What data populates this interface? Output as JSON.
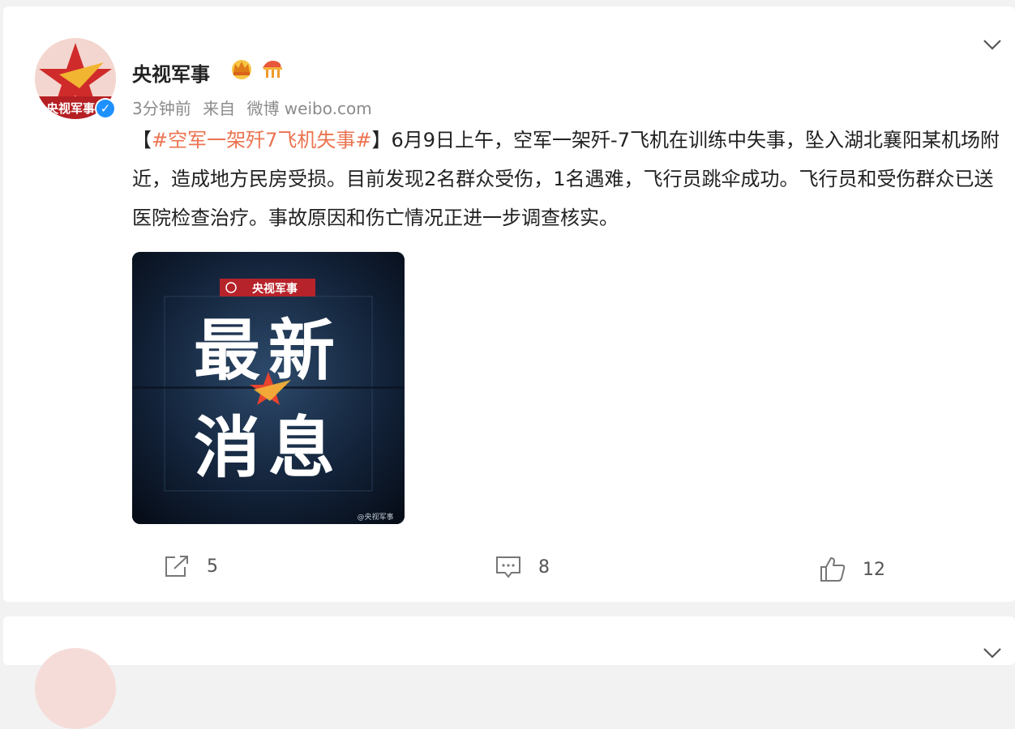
{
  "post": {
    "author": "央视军事",
    "avatar_text": "央视军事",
    "time": "3分钟前",
    "source_prefix": "来自",
    "source": "微博 weibo.com",
    "text_bracket_open": "【",
    "hashtag": "#空军一架歼7飞机失事#",
    "text_bracket_close": "】",
    "text_body": "6月9日上午，空军一架歼-7飞机在训练中失事，坠入湖北襄阳某机场附近，造成地方民房受损。目前发现2名群众受伤，1名遇难，飞行员跳伞成功。飞行员和受伤群众已送医院检查治疗。事故原因和伤亡情况正进一步调查核实。",
    "image": {
      "brand_label": "央视军事",
      "line1": "最新",
      "line2": "消息",
      "watermark": "@央视军事"
    },
    "actions": {
      "repost_count": "5",
      "comment_count": "8",
      "like_count": "12"
    }
  },
  "colors": {
    "hashtag": "#eb7350",
    "verified": "#1e90ff",
    "brand_red": "#c8282d"
  }
}
